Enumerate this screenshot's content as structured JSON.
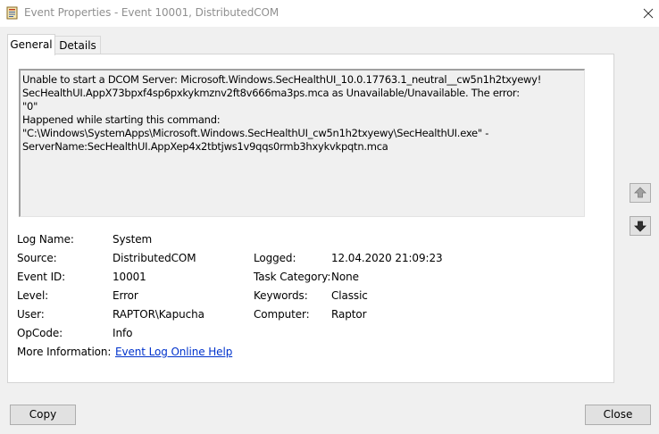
{
  "window": {
    "title": "Event Properties - Event 10001, DistributedCOM",
    "app_icon": "event-viewer-icon",
    "close_icon": "close-icon"
  },
  "tabs": [
    {
      "label": "General",
      "selected": true
    },
    {
      "label": "Details",
      "selected": false
    }
  ],
  "description": {
    "lines": [
      "Unable to start a DCOM Server: Microsoft.Windows.SecHealthUI_10.0.17763.1_neutral__cw5n1h2txyewy!",
      "SecHealthUI.AppX73bpxf4sp6pxkykmznv2ft8v666ma3ps.mca as Unavailable/Unavailable. The error:",
      "\"0\"",
      "Happened while starting this command:",
      "\"C:\\Windows\\SystemApps\\Microsoft.Windows.SecHealthUI_cw5n1h2txyewy\\SecHealthUI.exe\" -",
      "ServerName:SecHealthUI.AppXep4x2tbtjws1v9qqs0rmb3hxykvkpqtn.mca"
    ]
  },
  "fields": {
    "log_name": {
      "label": "Log Name:",
      "value": "System"
    },
    "source": {
      "label": "Source:",
      "value": "DistributedCOM"
    },
    "logged": {
      "label": "Logged:",
      "value": "12.04.2020 21:09:23"
    },
    "event_id": {
      "label": "Event ID:",
      "value": "10001"
    },
    "task_category": {
      "label": "Task Category:",
      "value": "None"
    },
    "level": {
      "label": "Level:",
      "value": "Error"
    },
    "keywords": {
      "label": "Keywords:",
      "value": "Classic"
    },
    "user": {
      "label": "User:",
      "value": "RAPTOR\\Kapucha"
    },
    "computer": {
      "label": "Computer:",
      "value": "Raptor"
    },
    "opcode": {
      "label": "OpCode:",
      "value": "Info"
    },
    "more_info": {
      "label": "More Information:",
      "link": "Event Log Online Help"
    }
  },
  "navigation": {
    "up_icon": "arrow-up-icon",
    "down_icon": "arrow-down-icon"
  },
  "buttons": {
    "copy": "Copy",
    "close": "Close"
  },
  "colors": {
    "link": "#0033cc",
    "title_text": "#909090",
    "button_face": "#e1e1e1",
    "button_border": "#adadad"
  }
}
